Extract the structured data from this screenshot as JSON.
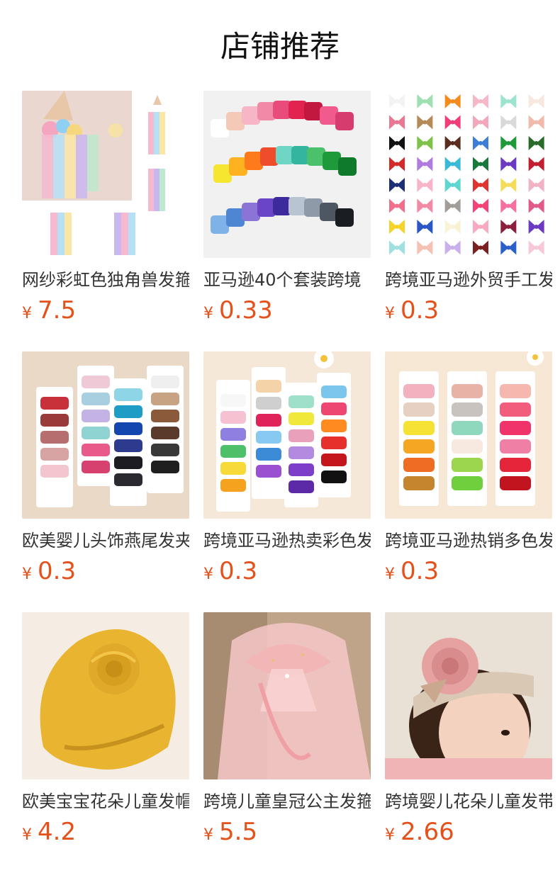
{
  "section_title": "店铺推荐",
  "currency_symbol": "¥",
  "accent_price_color": "#e4511b",
  "products": [
    {
      "name": "网纱彩虹色独角兽发箍",
      "price": "7.5",
      "image": "unicorn-tulle-headband-image"
    },
    {
      "name": "亚马逊40个套装跨境",
      "price": "0.33",
      "image": "40-piece-bow-set-image"
    },
    {
      "name": "跨境亚马逊外贸手工发夹",
      "price": "0.3",
      "image": "numbered-color-bows-image"
    },
    {
      "name": "欧美婴儿头饰燕尾发夹",
      "price": "0.3",
      "image": "baby-bow-clip-cards-image"
    },
    {
      "name": "跨境亚马逊热卖彩色发夹",
      "price": "0.3",
      "image": "colorful-bow-cards-image"
    },
    {
      "name": "跨境亚马逊热销多色发夹",
      "price": "0.3",
      "image": "multicolor-bow-cards-image"
    },
    {
      "name": "欧美宝宝花朵儿童发帽",
      "price": "4.2",
      "image": "yellow-flower-turban-image"
    },
    {
      "name": "跨境儿童皇冠公主发箍",
      "price": "5.5",
      "image": "pink-tulle-princess-headband-image"
    },
    {
      "name": "跨境婴儿花朵儿童发带",
      "price": "2.66",
      "image": "baby-flower-headband-image"
    }
  ]
}
